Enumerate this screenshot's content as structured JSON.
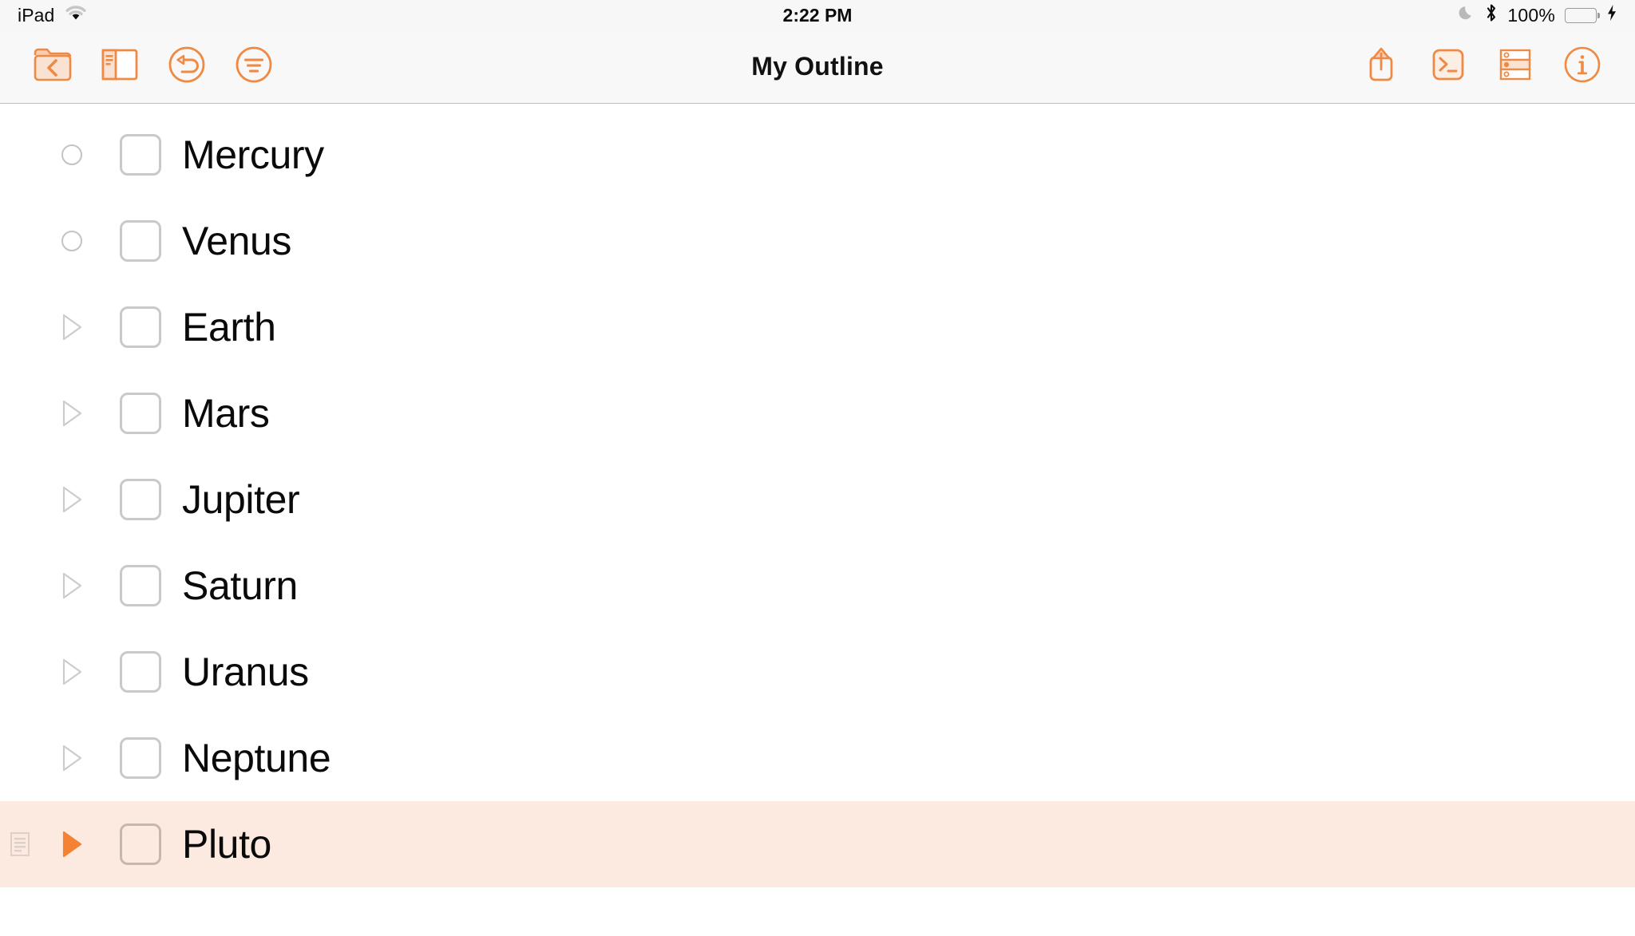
{
  "status_bar": {
    "carrier": "iPad",
    "wifi_icon": "wifi-icon",
    "time": "2:22 PM",
    "moon_icon": "moon-do-not-disturb-icon",
    "bluetooth_icon": "bluetooth-icon",
    "battery_percent": "100%",
    "battery_level": 100,
    "battery_color": "#4cd964",
    "charging_icon": "lightning-bolt-icon"
  },
  "toolbar": {
    "title": "My Outline",
    "accent_color": "#ef8a45",
    "background": "#f8f8f8",
    "left_buttons": [
      {
        "name": "documents-back-button",
        "icon": "folder-back-icon",
        "label": "Documents"
      },
      {
        "name": "sidebar-toggle-button",
        "icon": "sidebar-icon",
        "label": "Sidebar"
      },
      {
        "name": "undo-button",
        "icon": "undo-circle-icon",
        "label": "Undo"
      },
      {
        "name": "outline-style-button",
        "icon": "outline-lines-circle-icon",
        "label": "Outline"
      }
    ],
    "right_buttons": [
      {
        "name": "share-button",
        "icon": "share-up-arrow-icon",
        "label": "Share"
      },
      {
        "name": "console-button",
        "icon": "terminal-prompt-icon",
        "label": "Console"
      },
      {
        "name": "row-select-button",
        "icon": "row-selection-icon",
        "label": "Rows"
      },
      {
        "name": "info-button",
        "icon": "info-circle-icon",
        "label": "Info"
      }
    ]
  },
  "outline": {
    "selected_row_background": "#fce9df",
    "rows": [
      {
        "label": "Mercury",
        "handle": "circle",
        "has_note": false,
        "checked": false,
        "selected": false
      },
      {
        "label": "Venus",
        "handle": "circle",
        "has_note": false,
        "checked": false,
        "selected": false
      },
      {
        "label": "Earth",
        "handle": "triangle-gray",
        "has_note": false,
        "checked": false,
        "selected": false
      },
      {
        "label": "Mars",
        "handle": "triangle-gray",
        "has_note": false,
        "checked": false,
        "selected": false
      },
      {
        "label": "Jupiter",
        "handle": "triangle-gray",
        "has_note": false,
        "checked": false,
        "selected": false
      },
      {
        "label": "Saturn",
        "handle": "triangle-gray",
        "has_note": false,
        "checked": false,
        "selected": false
      },
      {
        "label": "Uranus",
        "handle": "triangle-gray",
        "has_note": false,
        "checked": false,
        "selected": false
      },
      {
        "label": "Neptune",
        "handle": "triangle-gray",
        "has_note": false,
        "checked": false,
        "selected": false
      },
      {
        "label": "Pluto",
        "handle": "triangle-orange",
        "has_note": true,
        "checked": false,
        "selected": true
      }
    ]
  }
}
